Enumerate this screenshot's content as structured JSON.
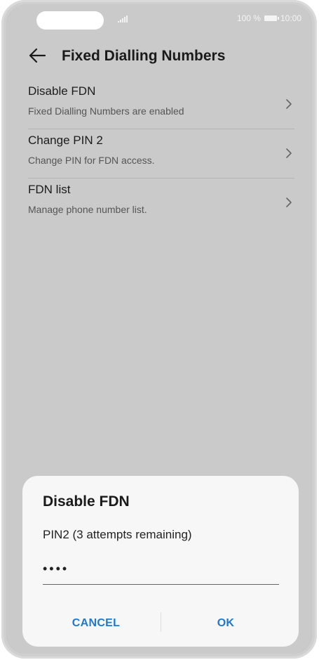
{
  "status_bar": {
    "battery_text": "100 %",
    "time": "10:00"
  },
  "app_bar": {
    "title": "Fixed Dialling Numbers"
  },
  "list": {
    "items": [
      {
        "title": "Disable FDN",
        "subtitle": "Fixed Dialling Numbers are enabled"
      },
      {
        "title": "Change PIN 2",
        "subtitle": "Change PIN for FDN access."
      },
      {
        "title": "FDN list",
        "subtitle": "Manage phone number list."
      }
    ]
  },
  "dialog": {
    "title": "Disable FDN",
    "message": "PIN2 (3 attempts remaining)",
    "pin_value": "••••",
    "cancel_label": "CANCEL",
    "ok_label": "OK"
  },
  "colors": {
    "accent": "#1e78d2",
    "screen_bg": "#cacaca",
    "dialog_bg": "#f7f7f7"
  }
}
